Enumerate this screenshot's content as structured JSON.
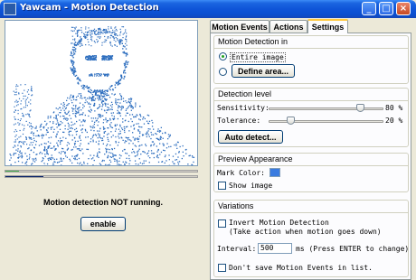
{
  "window": {
    "title": "Yawcam - Motion Detection",
    "minimize_glyph": "_",
    "maximize_glyph": "□",
    "close_glyph": "×"
  },
  "preview": {
    "status_text": "Motion detection NOT running.",
    "enable_label": "enable",
    "level_bar_fill": 0.07,
    "level_bar_color": "#4cb050",
    "trigger_bar_fill": 0.2,
    "trigger_bar_color": "#0a246a",
    "dot_color": "#2f6fbf"
  },
  "tabs": [
    {
      "label": "Motion Events",
      "active": false
    },
    {
      "label": "Actions",
      "active": false
    },
    {
      "label": "Settings",
      "active": true
    }
  ],
  "settings": {
    "motion_detection_in": {
      "title": "Motion Detection in",
      "entire_image_label": "Entire image",
      "entire_image_selected": true,
      "define_area_selected": false,
      "define_area_button": "Define area..."
    },
    "detection_level": {
      "title": "Detection level",
      "sensitivity_label": "Sensitivity:",
      "sensitivity_value": 80,
      "sensitivity_display": "80 %",
      "tolerance_label": "Tolerance:",
      "tolerance_value": 20,
      "tolerance_display": "20 %",
      "auto_detect_button": "Auto detect..."
    },
    "preview_appearance": {
      "title": "Preview Appearance",
      "mark_color_label": "Mark Color:",
      "mark_color": "#3a7be0",
      "show_image_label": "Show image",
      "show_image_checked": false
    },
    "variations": {
      "title": "Variations",
      "invert_label": "Invert Motion Detection",
      "invert_hint": "(Take action when motion goes down)",
      "invert_checked": false,
      "interval_label": "Interval:",
      "interval_value": "500",
      "interval_suffix": "ms (Press ENTER to change)",
      "dont_save_label": "Don't save Motion Events in list.",
      "dont_save_checked": false
    }
  }
}
